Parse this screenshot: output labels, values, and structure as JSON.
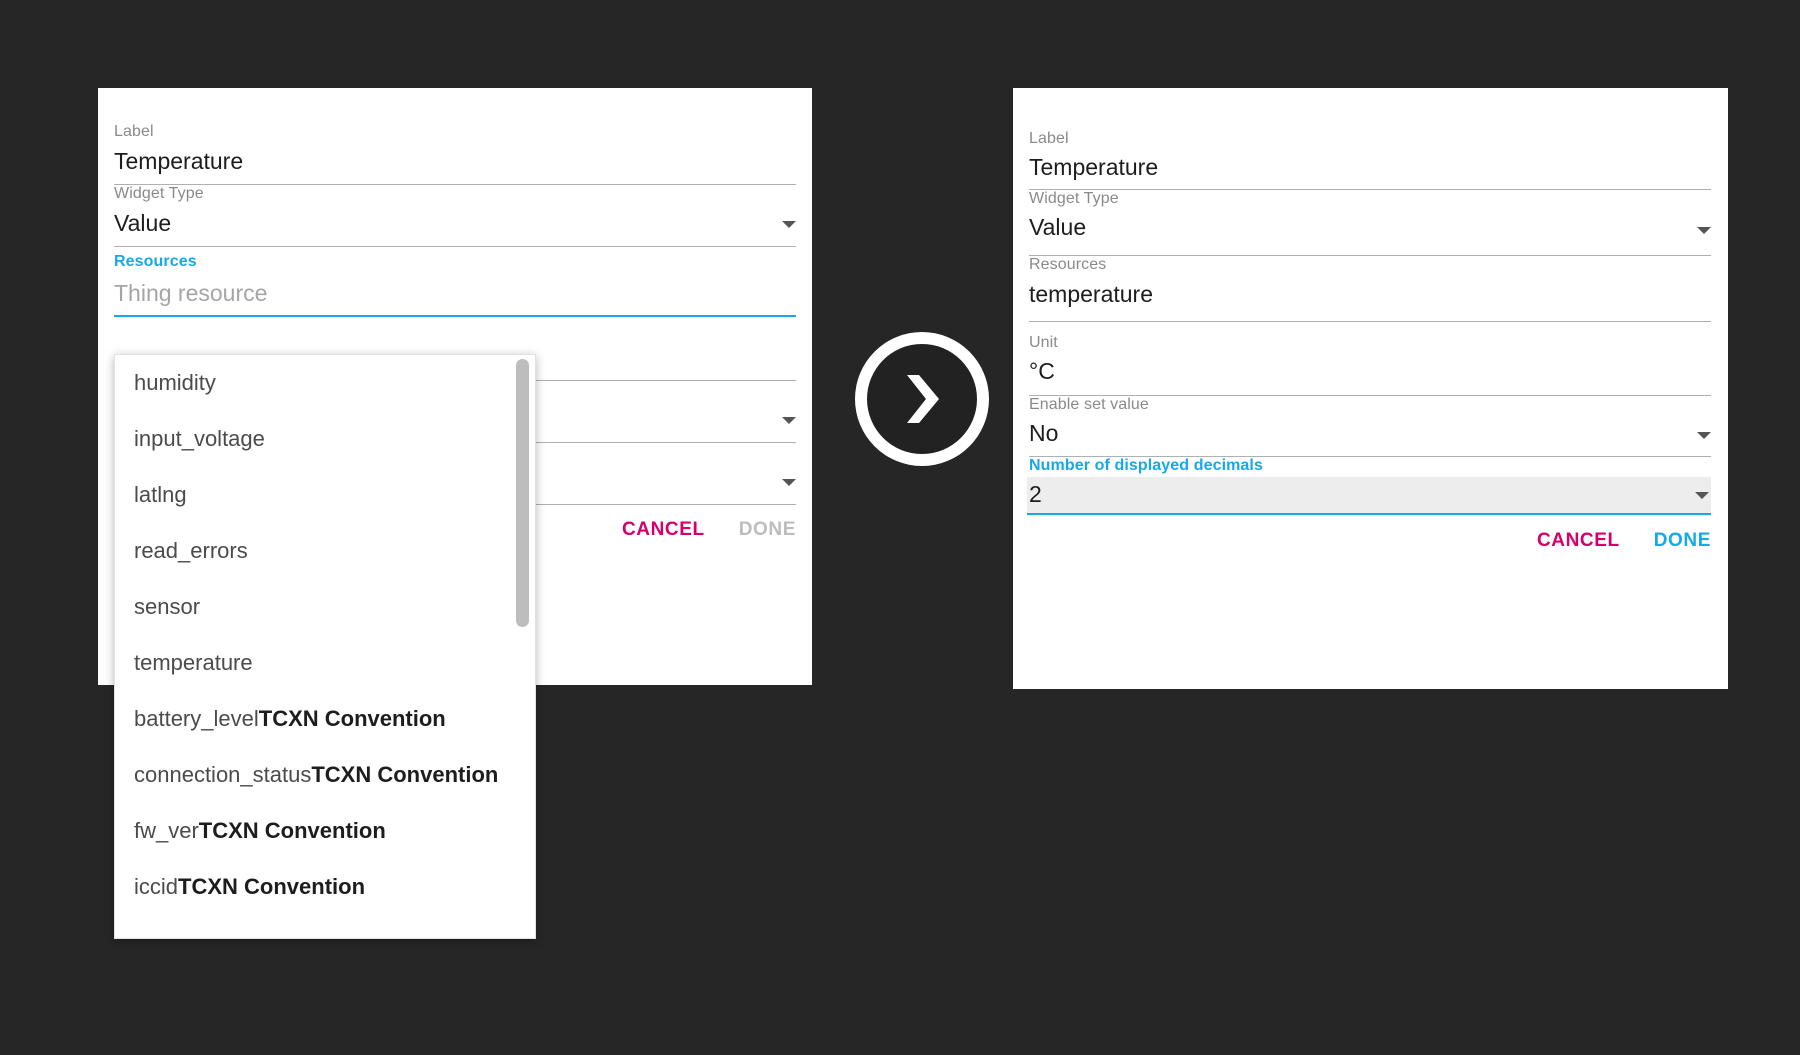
{
  "left_dialog": {
    "fields": [
      {
        "label": "Label",
        "value": "Temperature",
        "type": "text",
        "state": "normal"
      },
      {
        "label": "Widget Type",
        "value": "Value",
        "type": "select",
        "state": "normal"
      },
      {
        "label": "Resources",
        "value": "",
        "placeholder": "Thing resource",
        "type": "autocomplete",
        "state": "focused"
      }
    ],
    "buttons": {
      "cancel": "CANCEL",
      "done": "DONE"
    }
  },
  "resource_dropdown": {
    "options": [
      {
        "name": "humidity",
        "suffix": ""
      },
      {
        "name": "input_voltage",
        "suffix": ""
      },
      {
        "name": "latlng",
        "suffix": ""
      },
      {
        "name": "read_errors",
        "suffix": ""
      },
      {
        "name": "sensor",
        "suffix": ""
      },
      {
        "name": "temperature",
        "suffix": ""
      },
      {
        "name": "battery_level",
        "suffix": "TCXN Convention"
      },
      {
        "name": "connection_status",
        "suffix": "TCXN Convention"
      },
      {
        "name": "fw_ver",
        "suffix": "TCXN Convention"
      },
      {
        "name": "iccid",
        "suffix": "TCXN Convention"
      }
    ]
  },
  "arrow": {
    "icon": "chevron-right-icon"
  },
  "right_dialog": {
    "fields": [
      {
        "label": "Label",
        "value": "Temperature",
        "type": "text",
        "state": "normal"
      },
      {
        "label": "Widget Type",
        "value": "Value",
        "type": "select",
        "state": "normal"
      },
      {
        "label": "Resources",
        "value": "temperature",
        "type": "text",
        "state": "normal"
      },
      {
        "label": "Unit",
        "value": "°C",
        "type": "text",
        "state": "normal"
      },
      {
        "label": "Enable set value",
        "value": "No",
        "type": "select",
        "state": "normal"
      },
      {
        "label": "Number of displayed decimals",
        "value": "2",
        "type": "select",
        "state": "focused"
      }
    ],
    "buttons": {
      "cancel": "CANCEL",
      "done": "DONE"
    }
  },
  "colors": {
    "accent_blue": "#17a8e8",
    "cancel_magenta": "#d6006d",
    "disabled_grey": "#bdbdbd",
    "background": "#262626"
  }
}
